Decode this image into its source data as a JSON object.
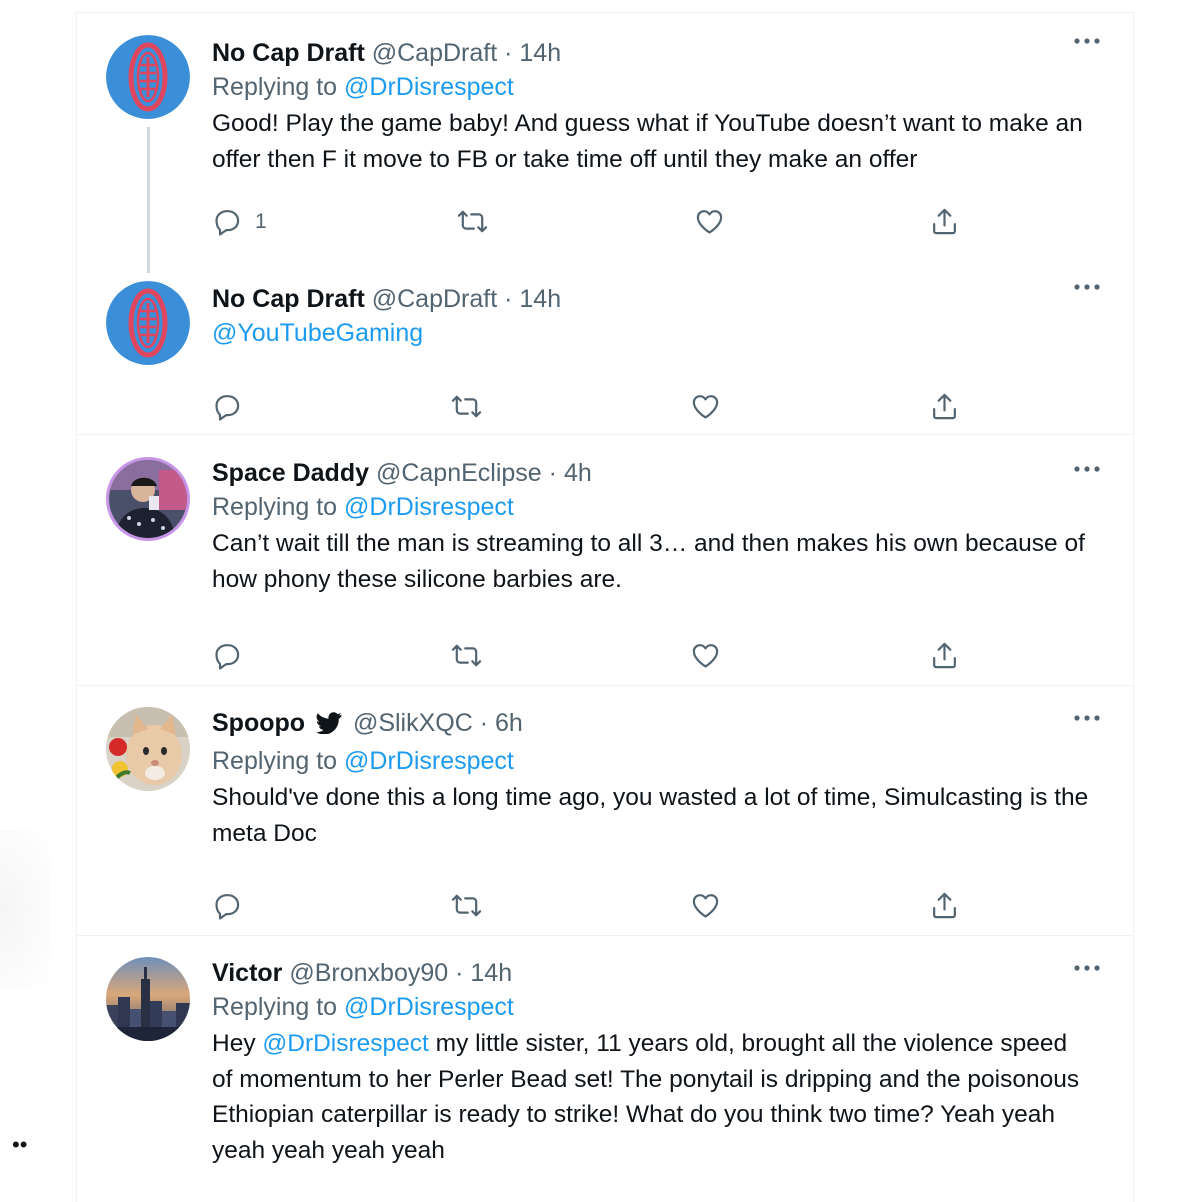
{
  "tweets": [
    {
      "name": "No Cap Draft",
      "handle": "@CapDraft",
      "time": "14h",
      "reply_prefix": "Replying to",
      "reply_to": "@DrDisrespect",
      "text": "Good! Play the game baby! And guess what if YouTube doesn’t want to make an offer then F it move to FB or take time off until they make an offer",
      "reply_count": "1",
      "avatar_icon": "football-logo-avatar"
    },
    {
      "name": "No Cap Draft",
      "handle": "@CapDraft",
      "time": "14h",
      "mention": "@YouTubeGaming",
      "avatar_icon": "football-logo-avatar"
    },
    {
      "name": "Space Daddy",
      "handle": "@CapnEclipse",
      "time": "4h",
      "reply_prefix": "Replying to",
      "reply_to": "@DrDisrespect",
      "text": "Can’t wait till the man is streaming to all 3… and then makes his own because of how phony these silicone barbies are.",
      "avatar_icon": "user-photo-avatar"
    },
    {
      "name": "Spoopo",
      "handle": "@SlikXQC",
      "time": "6h",
      "reply_prefix": "Replying to",
      "reply_to": "@DrDisrespect",
      "text": "Should've done this a long time ago, you wasted a lot of time, Simulcasting is the meta Doc",
      "badge_icon": "twitter-bird-icon",
      "avatar_icon": "cat-photo-avatar"
    },
    {
      "name": "Victor",
      "handle": "@Bronxboy90",
      "time": "14h",
      "reply_prefix": "Replying to",
      "reply_to": "@DrDisrespect",
      "text_prefix": "Hey",
      "text_mention": "@DrDisrespect",
      "text_rest": "my little sister, 11 years old, brought all the violence speed of momentum to her Perler Bead set! The ponytail is dripping and the poisonous Ethiopian caterpillar is ready to strike! What do you think two time? Yeah yeah yeah yeah yeah yeah",
      "avatar_icon": "city-skyline-avatar"
    }
  ],
  "separator_dot": "·",
  "edge_text": "••",
  "colors": {
    "text": "#0f1419",
    "secondary": "#536471",
    "link": "#1d9bf0",
    "border": "#eff3f4",
    "avatar_football_bg": "#3b8fd9",
    "avatar_football_ball": "#e0455e"
  }
}
